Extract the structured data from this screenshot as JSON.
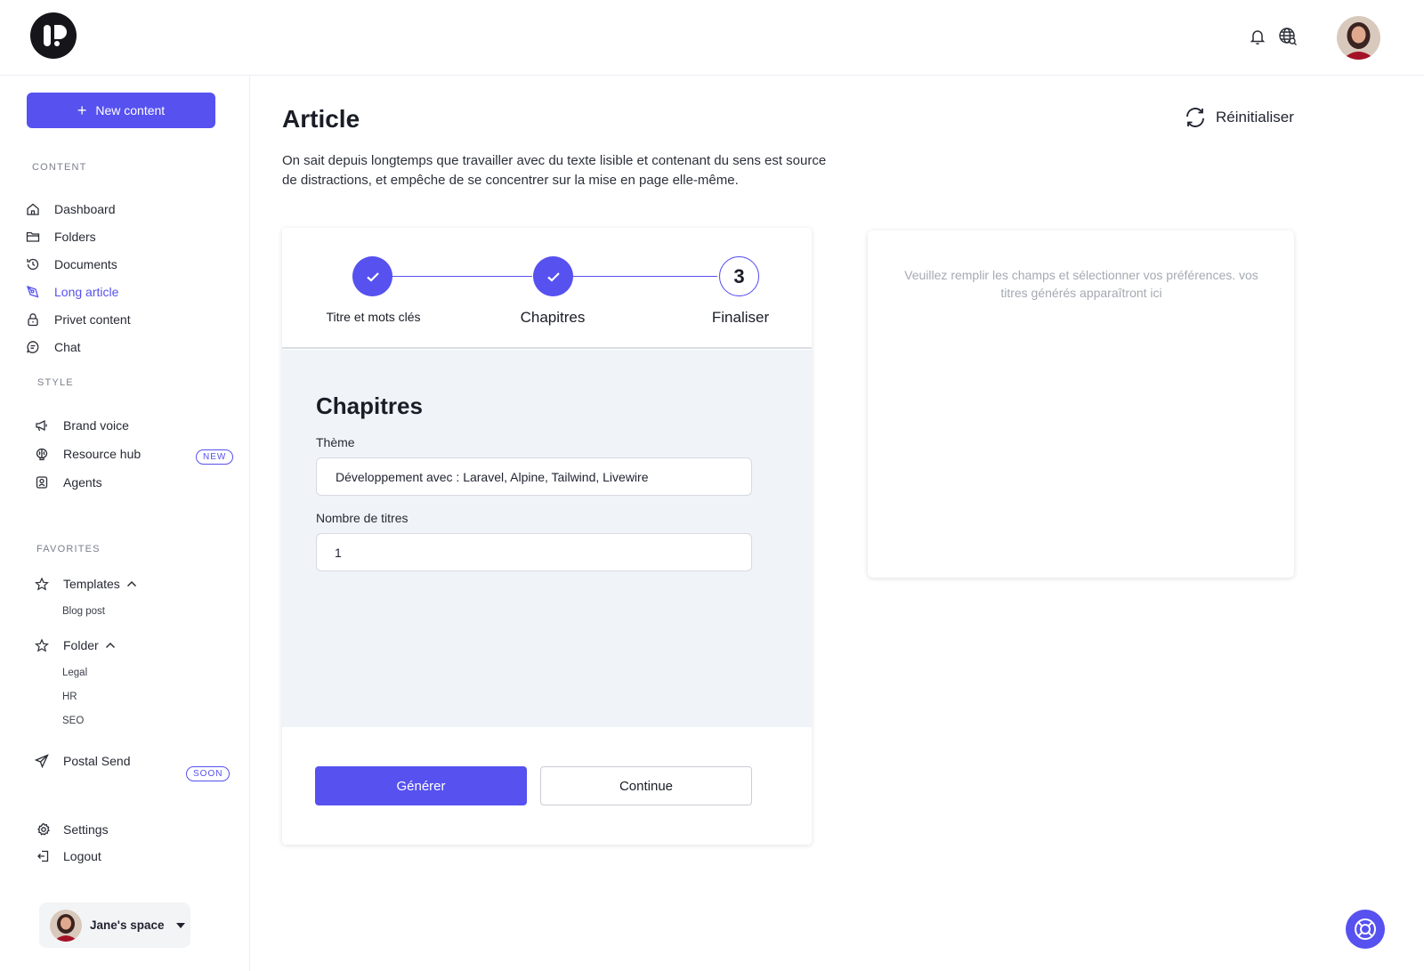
{
  "header": {
    "logo": "logo-icon",
    "icons": [
      "bell-icon",
      "globe-search-icon"
    ],
    "avatar": "user-avatar"
  },
  "sidebar": {
    "new_content_label": "New content",
    "sections": {
      "content": "CONTENT",
      "style": "STYLE",
      "favorites": "FAVORITES"
    },
    "content_items": [
      {
        "label": "Dashboard",
        "icon": "home-icon"
      },
      {
        "label": "Folders",
        "icon": "folder-icon"
      },
      {
        "label": "Documents",
        "icon": "history-icon"
      },
      {
        "label": "Long article",
        "icon": "pen-icon",
        "active": true
      },
      {
        "label": "Privet content",
        "icon": "lock-icon"
      },
      {
        "label": "Chat",
        "icon": "chat-icon"
      }
    ],
    "style_items": [
      {
        "label": "Brand voice",
        "icon": "megaphone-icon"
      },
      {
        "label": "Resource hub",
        "icon": "brain-icon",
        "badge": "NEW"
      },
      {
        "label": "Agents",
        "icon": "agent-icon"
      }
    ],
    "favorites": [
      {
        "label": "Templates",
        "icon": "star-icon",
        "children": [
          "Blog post"
        ]
      },
      {
        "label": "Folder",
        "icon": "star-icon",
        "children": [
          "Legal",
          "HR",
          "SEO"
        ]
      }
    ],
    "postal_send": {
      "label": "Postal Send",
      "badge": "SOON",
      "icon": "send-icon"
    },
    "settings_label": "Settings",
    "logout_label": "Logout",
    "workspace_label": "Jane's space"
  },
  "main": {
    "title": "Article",
    "description": "On sait depuis longtemps que travailler avec du texte lisible et contenant du sens est source de distractions, et empêche de se concentrer sur la mise en page elle-même.",
    "reset_label": "Réinitialiser",
    "steps": [
      {
        "label": "Titre et mots clés",
        "status": "done"
      },
      {
        "label": "Chapitres",
        "status": "done"
      },
      {
        "label": "Finaliser",
        "status": "current",
        "number": "3"
      }
    ],
    "form": {
      "title": "Chapitres",
      "theme_label": "Thème",
      "theme_value": "Développement avec : Laravel, Alpine, Tailwind, Livewire",
      "count_label": "Nombre de titres",
      "count_value": "1"
    },
    "generate_label": "Générer",
    "continue_label": "Continue",
    "preview_placeholder": "Veuillez remplir les champs et sélectionner vos préférences. vos titres générés apparaîtront ici"
  },
  "colors": {
    "accent": "#5651ef",
    "form_bg": "#f0f3f8"
  }
}
